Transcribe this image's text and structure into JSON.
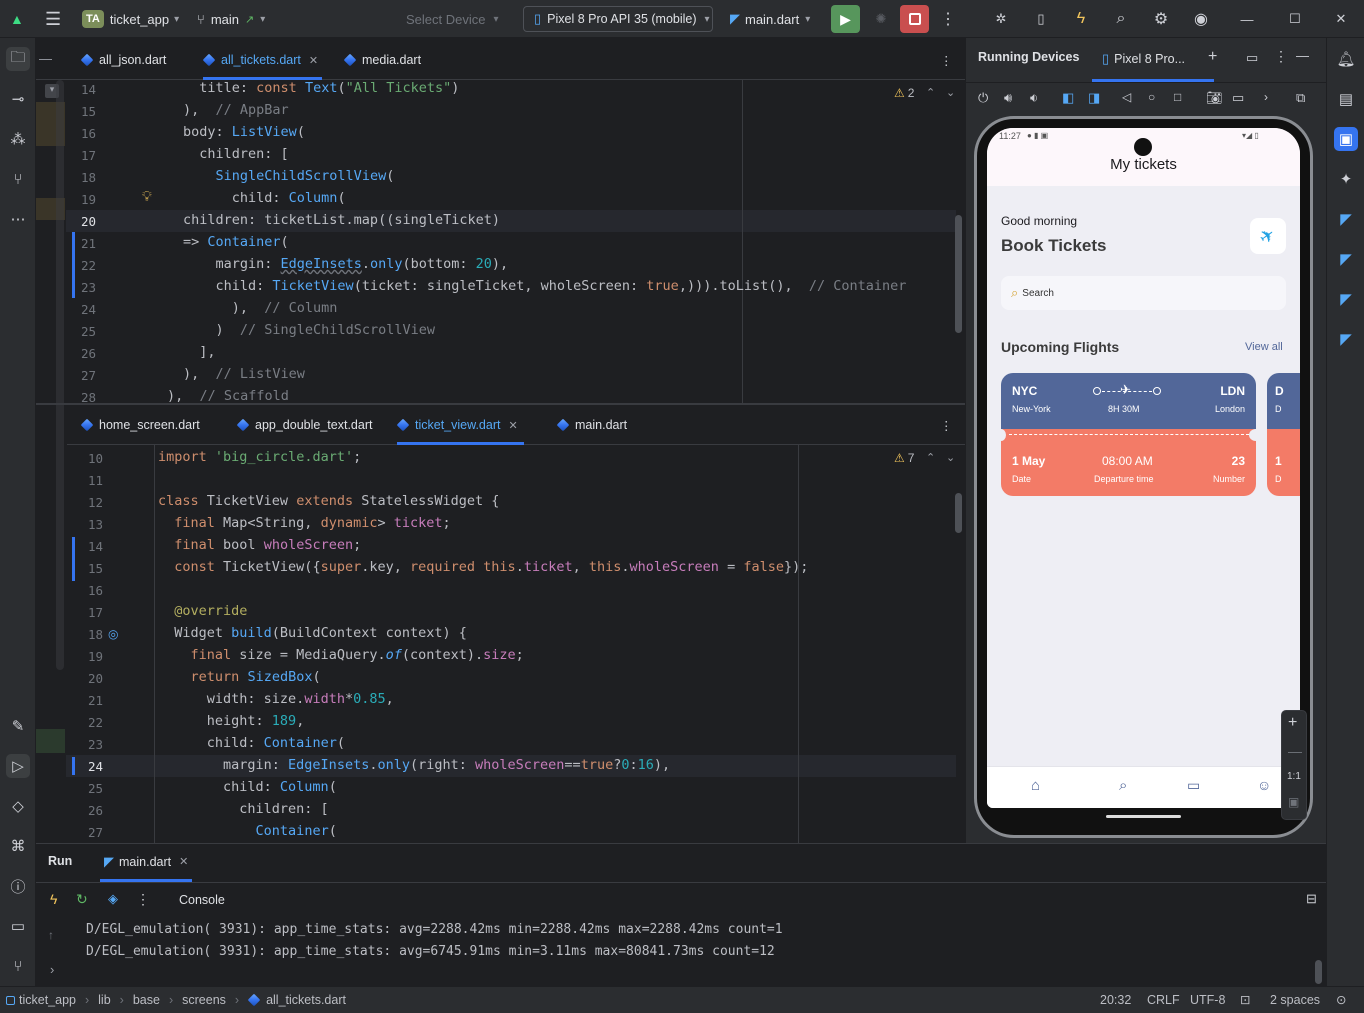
{
  "titlebar": {
    "project_badge": "TA",
    "project_name": "ticket_app",
    "branch": "main",
    "select_device": "Select Device",
    "device": "Pixel 8 Pro API 35 (mobile)",
    "run_config": "main.dart"
  },
  "editor_top": {
    "tabs": [
      {
        "label": "all_json.dart"
      },
      {
        "label": "all_tickets.dart"
      },
      {
        "label": "media.dart"
      }
    ],
    "warnings": "2",
    "lines": [
      {
        "n": "14"
      },
      {
        "n": "15"
      },
      {
        "n": "16"
      },
      {
        "n": "17"
      },
      {
        "n": "18"
      },
      {
        "n": "19"
      },
      {
        "n": "20"
      },
      {
        "n": "21"
      },
      {
        "n": "22"
      },
      {
        "n": "23"
      },
      {
        "n": "24"
      },
      {
        "n": "25"
      },
      {
        "n": "26"
      },
      {
        "n": "27"
      },
      {
        "n": "28"
      }
    ]
  },
  "editor_bottom": {
    "tabs": [
      {
        "label": "home_screen.dart"
      },
      {
        "label": "app_double_text.dart"
      },
      {
        "label": "ticket_view.dart"
      },
      {
        "label": "main.dart"
      }
    ],
    "warnings": "7",
    "lines": [
      {
        "n": "10"
      },
      {
        "n": "11"
      },
      {
        "n": "12"
      },
      {
        "n": "13"
      },
      {
        "n": "14"
      },
      {
        "n": "15"
      },
      {
        "n": "16"
      },
      {
        "n": "17"
      },
      {
        "n": "18"
      },
      {
        "n": "19"
      },
      {
        "n": "20"
      },
      {
        "n": "21"
      },
      {
        "n": "22"
      },
      {
        "n": "23"
      },
      {
        "n": "24"
      },
      {
        "n": "25"
      },
      {
        "n": "26"
      },
      {
        "n": "27"
      }
    ]
  },
  "device_panel": {
    "title": "Running Devices",
    "device_tab": "Pixel 8 Pro...",
    "zoom_label": "1:1"
  },
  "phone": {
    "status_time": "11:27",
    "appbar_title": "My tickets",
    "greeting": "Good morning",
    "heading": "Book Tickets",
    "search_placeholder": "Search",
    "section_title": "Upcoming Flights",
    "view_all": "View all",
    "ticket": {
      "from_code": "NYC",
      "from_name": "New-York",
      "duration": "8H 30M",
      "to_code": "LDN",
      "to_name": "London",
      "date": "1 May",
      "date_label": "Date",
      "time": "08:00 AM",
      "time_label": "Departure time",
      "number": "23",
      "number_label": "Number"
    },
    "ticket_peek": {
      "code": "D",
      "name": "D",
      "date": "1",
      "label": "D"
    },
    "colors": {
      "ticket_top": "#526799",
      "ticket_bottom": "#f37b67",
      "accent": "#526799"
    }
  },
  "runpanel": {
    "tab_run": "Run",
    "tab_file": "main.dart",
    "console_label": "Console",
    "log": [
      "D/EGL_emulation( 3931): app_time_stats: avg=2288.42ms min=2288.42ms max=2288.42ms count=1",
      "D/EGL_emulation( 3931): app_time_stats: avg=6745.91ms min=3.11ms max=80841.73ms count=12"
    ]
  },
  "statusbar": {
    "crumbs": [
      "ticket_app",
      "lib",
      "base",
      "screens",
      "all_tickets.dart"
    ],
    "position": "20:32",
    "line_sep": "CRLF",
    "encoding": "UTF-8",
    "indent": "2 spaces"
  }
}
